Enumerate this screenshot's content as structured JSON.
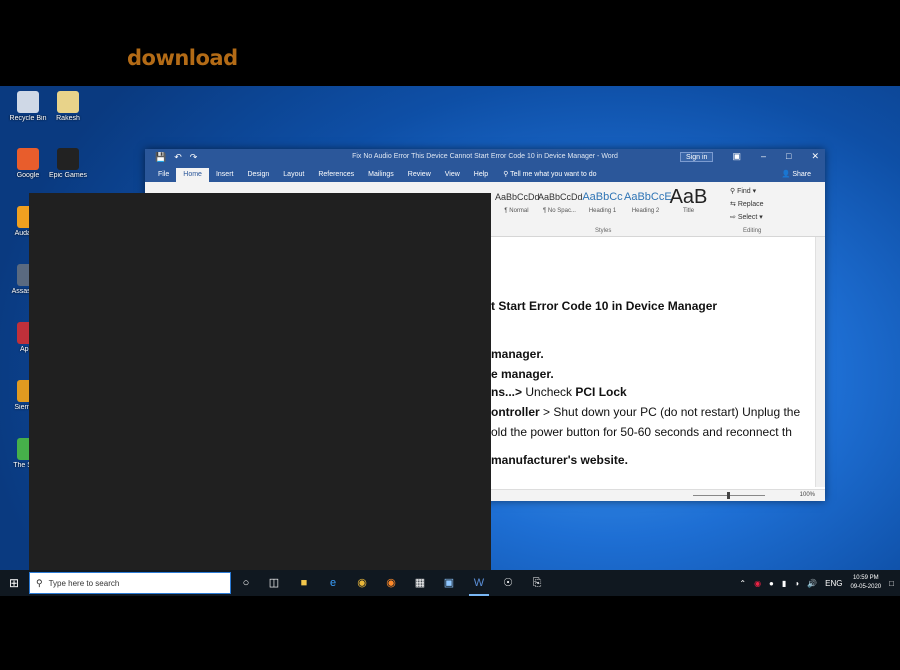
{
  "overlay": {
    "text": "download"
  },
  "desktop_icons": [
    {
      "label": "Recycle Bin",
      "color": "#cfd8e6"
    },
    {
      "label": "Rakesh",
      "color": "#e8d38a"
    },
    {
      "label": "Google",
      "color": "#e85d2c"
    },
    {
      "label": "Epic Games",
      "color": "#222222"
    },
    {
      "label": "Audacity",
      "color": "#f0a020"
    },
    {
      "label": "Assassin's",
      "color": "#5a6a80"
    },
    {
      "label": "Apex",
      "color": "#c0303a"
    },
    {
      "label": "Siemens",
      "color": "#e09a20"
    },
    {
      "label": "The Sims",
      "color": "#46b04a"
    }
  ],
  "word": {
    "title": "Fix No Audio Error This Device Cannot Start Error Code 10 in Device Manager - Word",
    "signin": "Sign in",
    "tabs": [
      "File",
      "Home",
      "Insert",
      "Design",
      "Layout",
      "References",
      "Mailings",
      "Review",
      "View",
      "Help"
    ],
    "active_tab": "Home",
    "tellme": "Tell me what you want to do",
    "share": "Share",
    "styles": [
      {
        "sample": "AaBbCcDd",
        "label": "¶ Normal",
        "kind": "normal"
      },
      {
        "sample": "AaBbCcDd",
        "label": "¶ No Spac...",
        "kind": "normal"
      },
      {
        "sample": "AaBbCc",
        "label": "Heading 1",
        "kind": "h"
      },
      {
        "sample": "AaBbCcE",
        "label": "Heading 2",
        "kind": "h"
      },
      {
        "sample": "AaB",
        "label": "Title",
        "kind": "t"
      }
    ],
    "styles_group": "Styles",
    "editing": {
      "find": "Find",
      "replace": "Replace",
      "select": "Select",
      "group": "Editing"
    },
    "doc_lines": [
      {
        "bold": "t Start Error Code 10 in Device Manager",
        "rest": ""
      },
      {
        "bold": "manager.",
        "rest": ""
      },
      {
        "bold": "e manager.",
        "rest": ""
      },
      {
        "bold": "ns...>",
        "rest": " Uncheck ",
        "bold2": "PCI Lock"
      },
      {
        "bold": "ontroller",
        "rest": " > Shut down your PC (do not restart) Unplug the"
      },
      {
        "bold": "",
        "rest": "old the power button for 50-60 seconds and reconnect th"
      },
      {
        "bold": "manufacturer's website.",
        "rest": ""
      }
    ],
    "zoom": "100%"
  },
  "taskbar": {
    "search_placeholder": "Type here to search",
    "lang": "ENG",
    "time": "10:59 PM",
    "date": "09-05-2020"
  }
}
